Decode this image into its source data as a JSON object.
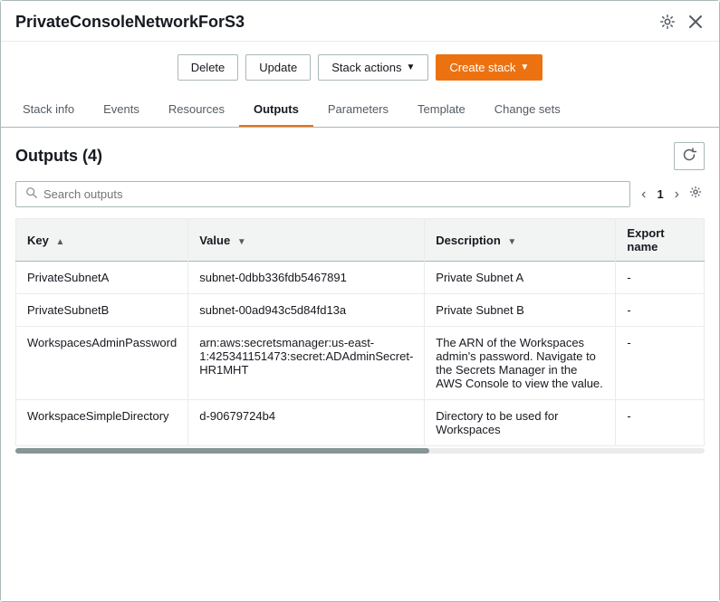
{
  "window": {
    "title": "PrivateConsoleNetworkForS3"
  },
  "toolbar": {
    "delete_label": "Delete",
    "update_label": "Update",
    "stack_actions_label": "Stack actions",
    "create_stack_label": "Create stack"
  },
  "tabs": [
    {
      "id": "stack-info",
      "label": "Stack info",
      "active": false
    },
    {
      "id": "events",
      "label": "Events",
      "active": false
    },
    {
      "id": "resources",
      "label": "Resources",
      "active": false
    },
    {
      "id": "outputs",
      "label": "Outputs",
      "active": true
    },
    {
      "id": "parameters",
      "label": "Parameters",
      "active": false
    },
    {
      "id": "template",
      "label": "Template",
      "active": false
    },
    {
      "id": "change-sets",
      "label": "Change sets",
      "active": false
    }
  ],
  "outputs_section": {
    "title": "Outputs",
    "count": "(4)",
    "search_placeholder": "Search outputs",
    "page_current": "1"
  },
  "table": {
    "columns": [
      {
        "id": "key",
        "label": "Key",
        "sort": "asc"
      },
      {
        "id": "value",
        "label": "Value",
        "sort": "desc"
      },
      {
        "id": "description",
        "label": "Description",
        "sort": "desc"
      },
      {
        "id": "export_name",
        "label": "Export name"
      }
    ],
    "rows": [
      {
        "key": "PrivateSubnetA",
        "value": "subnet-0dbb336fdb5467891",
        "description": "Private Subnet A",
        "export_name": "-"
      },
      {
        "key": "PrivateSubnetB",
        "value": "subnet-00ad943c5d84fd13a",
        "description": "Private Subnet B",
        "export_name": "-"
      },
      {
        "key": "WorkspacesAdminPassword",
        "value": "arn:aws:secretsmanager:us-east-1:425341151473:secret:ADAdminSecret-HR1MHT",
        "description": "The ARN of the Workspaces admin's password. Navigate to the Secrets Manager in the AWS Console to view the value.",
        "export_name": "-"
      },
      {
        "key": "WorkspaceSimpleDirectory",
        "value": "d-90679724b4",
        "description": "Directory to be used for Workspaces",
        "export_name": "-"
      }
    ]
  }
}
